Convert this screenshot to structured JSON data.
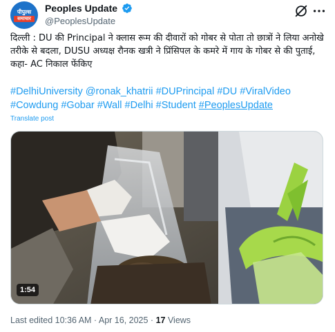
{
  "account": {
    "display_name": "Peoples Update",
    "handle": "@PeoplesUpdate",
    "avatar_text_top": "पीपुल्स",
    "avatar_text_bottom": "समाचार",
    "verified": true,
    "verified_color": "#1d9bf0"
  },
  "actions": {
    "grok_icon": "grok-icon",
    "more_icon": "more-options-icon"
  },
  "tweet": {
    "text": "दिल्ली : DU की Principal ने क्लास रूम की दीवारों को गोबर से पोता तो छात्रों ने लिया अनोखे तरीके से बदला, DUSU अध्यक्ष रौनक खत्री ने प्रिंसिपल के कमरे में गाय के गोबर से की पुताई, कहा- AC निकाल फेंकिए",
    "hashtags": [
      "#DelhiUniversity",
      "@ronak_khatrii",
      "#DUPrincipal",
      "#DU",
      "#ViralVideo",
      "#Cowdung",
      "#Gobar",
      "#Wall",
      "#Delhi",
      "#Student",
      "#PeoplesUpdate"
    ],
    "translate_label": "Translate post"
  },
  "media": {
    "duration": "1:54"
  },
  "meta": {
    "edited_label": "Last edited 10:36 AM · Apr 16, 2025 · ",
    "views_count": "17",
    "views_label": " Views"
  },
  "colors": {
    "link": "#1d9bf0",
    "muted": "#536471",
    "text": "#0f1419"
  }
}
